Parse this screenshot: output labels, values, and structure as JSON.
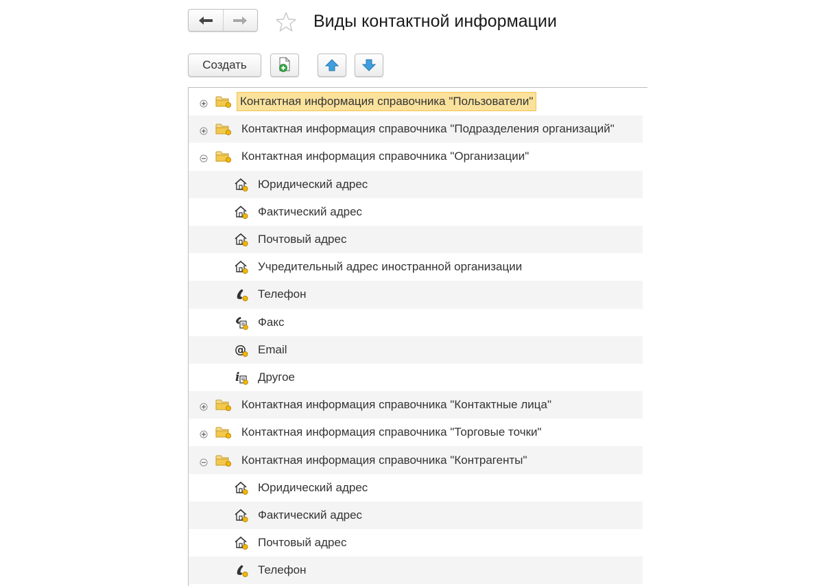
{
  "window": {
    "title": "Виды контактной информации"
  },
  "toolbar": {
    "create_label": "Создать"
  },
  "tree": [
    {
      "kind": "group",
      "expanded": false,
      "selected": true,
      "label": "Контактная информация справочника \"Пользователи\""
    },
    {
      "kind": "group",
      "expanded": false,
      "selected": false,
      "label": "Контактная информация справочника \"Подразделения организаций\""
    },
    {
      "kind": "group",
      "expanded": true,
      "selected": false,
      "label": "Контактная информация справочника \"Организации\""
    },
    {
      "kind": "item",
      "icon": "address-icon",
      "label": "Юридический адрес"
    },
    {
      "kind": "item",
      "icon": "address-icon",
      "label": "Фактический адрес"
    },
    {
      "kind": "item",
      "icon": "address-icon",
      "label": "Почтовый адрес"
    },
    {
      "kind": "item",
      "icon": "address-icon",
      "label": "Учредительный адрес иностранной организации"
    },
    {
      "kind": "item",
      "icon": "phone-icon",
      "label": "Телефон"
    },
    {
      "kind": "item",
      "icon": "fax-icon",
      "label": "Факс"
    },
    {
      "kind": "item",
      "icon": "email-icon",
      "label": "Email"
    },
    {
      "kind": "item",
      "icon": "other-icon",
      "label": "Другое"
    },
    {
      "kind": "group",
      "expanded": false,
      "selected": false,
      "label": "Контактная информация справочника \"Контактные лица\""
    },
    {
      "kind": "group",
      "expanded": false,
      "selected": false,
      "label": "Контактная информация справочника \"Торговые точки\""
    },
    {
      "kind": "group",
      "expanded": true,
      "selected": false,
      "label": "Контактная информация справочника \"Контрагенты\""
    },
    {
      "kind": "item",
      "icon": "address-icon",
      "label": "Юридический адрес"
    },
    {
      "kind": "item",
      "icon": "address-icon",
      "label": "Фактический адрес"
    },
    {
      "kind": "item",
      "icon": "address-icon",
      "label": "Почтовый адрес"
    },
    {
      "kind": "item",
      "icon": "phone-icon",
      "label": "Телефон"
    }
  ],
  "colors": {
    "selection_bg": "#fbe29c",
    "selection_border": "#f1c24b",
    "folder": "#f2c94c",
    "arrow_blue": "#3f9fdc",
    "alt_row": "#f4f4f4"
  }
}
